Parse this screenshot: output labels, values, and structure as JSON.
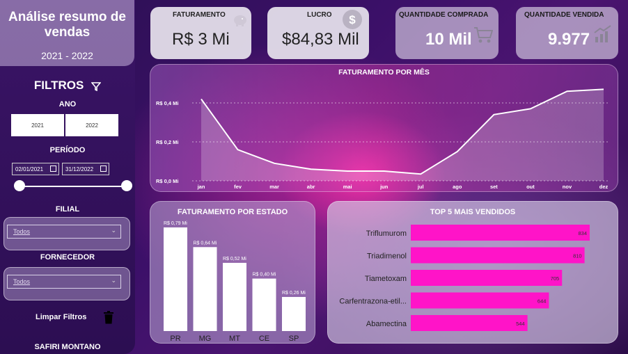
{
  "sidebar": {
    "title": "Análise resumo de vendas",
    "years_range": "2021 - 2022",
    "filters_label": "FILTROS",
    "year_label": "ANO",
    "year_options": [
      "2021",
      "2022"
    ],
    "period_label": "PERÍODO",
    "date_start": "02/01/2021",
    "date_end": "31/12/2022",
    "branch_label": "FILIAL",
    "branch_value": "Todos",
    "supplier_label": "FORNECEDOR",
    "supplier_value": "Todos",
    "clear_label": "Limpar Filtros",
    "footer": "SAFIRI MONTANO"
  },
  "kpis": [
    {
      "label": "FATURAMENTO",
      "value": "R$ 3 Mi",
      "icon": "piggy-bank-icon"
    },
    {
      "label": "LUCRO",
      "value": "$84,83 Mil",
      "icon": "dollar-coin-icon"
    },
    {
      "label": "QUANTIDADE COMPRADA",
      "value": "10 Mil",
      "icon": "shopping-cart-icon"
    },
    {
      "label": "QUANTIDADE VENDIDA",
      "value": "9.977",
      "icon": "growth-chart-icon"
    }
  ],
  "chart_data": [
    {
      "type": "area",
      "title": "FATURAMENTO POR MÊS",
      "categories": [
        "jan",
        "fev",
        "mar",
        "abr",
        "mai",
        "jun",
        "jul",
        "ago",
        "set",
        "out",
        "nov",
        "dez"
      ],
      "values": [
        0.42,
        0.16,
        0.09,
        0.06,
        0.05,
        0.05,
        0.035,
        0.15,
        0.34,
        0.37,
        0.46,
        0.47
      ],
      "y_ticks": [
        "R$ 0,0 Mi",
        "R$ 0,2 Mi",
        "R$ 0,4 Mi"
      ],
      "ylim": [
        0,
        0.5
      ],
      "grid": true
    },
    {
      "type": "bar",
      "title": "FATURAMENTO  POR ESTADO",
      "categories": [
        "PR",
        "MG",
        "MT",
        "CE",
        "SP"
      ],
      "values": [
        0.79,
        0.64,
        0.52,
        0.4,
        0.26
      ],
      "labels": [
        "R$ 0,79 Mi",
        "R$ 0,64 Mi",
        "R$ 0,52 Mi",
        "R$ 0,40 Mi",
        "R$ 0,26 Mi"
      ],
      "ylim": [
        0,
        0.79
      ]
    },
    {
      "type": "bar",
      "orientation": "horizontal",
      "title": "TOP 5 MAIS VENDIDOS",
      "categories": [
        "Triflumurom",
        "Triadimenol",
        "Tiametoxam",
        "Carfentrazona-etil...",
        "Abamectina"
      ],
      "values": [
        834,
        810,
        705,
        644,
        544
      ],
      "xlim": [
        0,
        834
      ]
    }
  ],
  "colors": {
    "accent_pink": "#ff14c8",
    "bar_white": "#ffffff",
    "line_white": "#ffffff"
  }
}
